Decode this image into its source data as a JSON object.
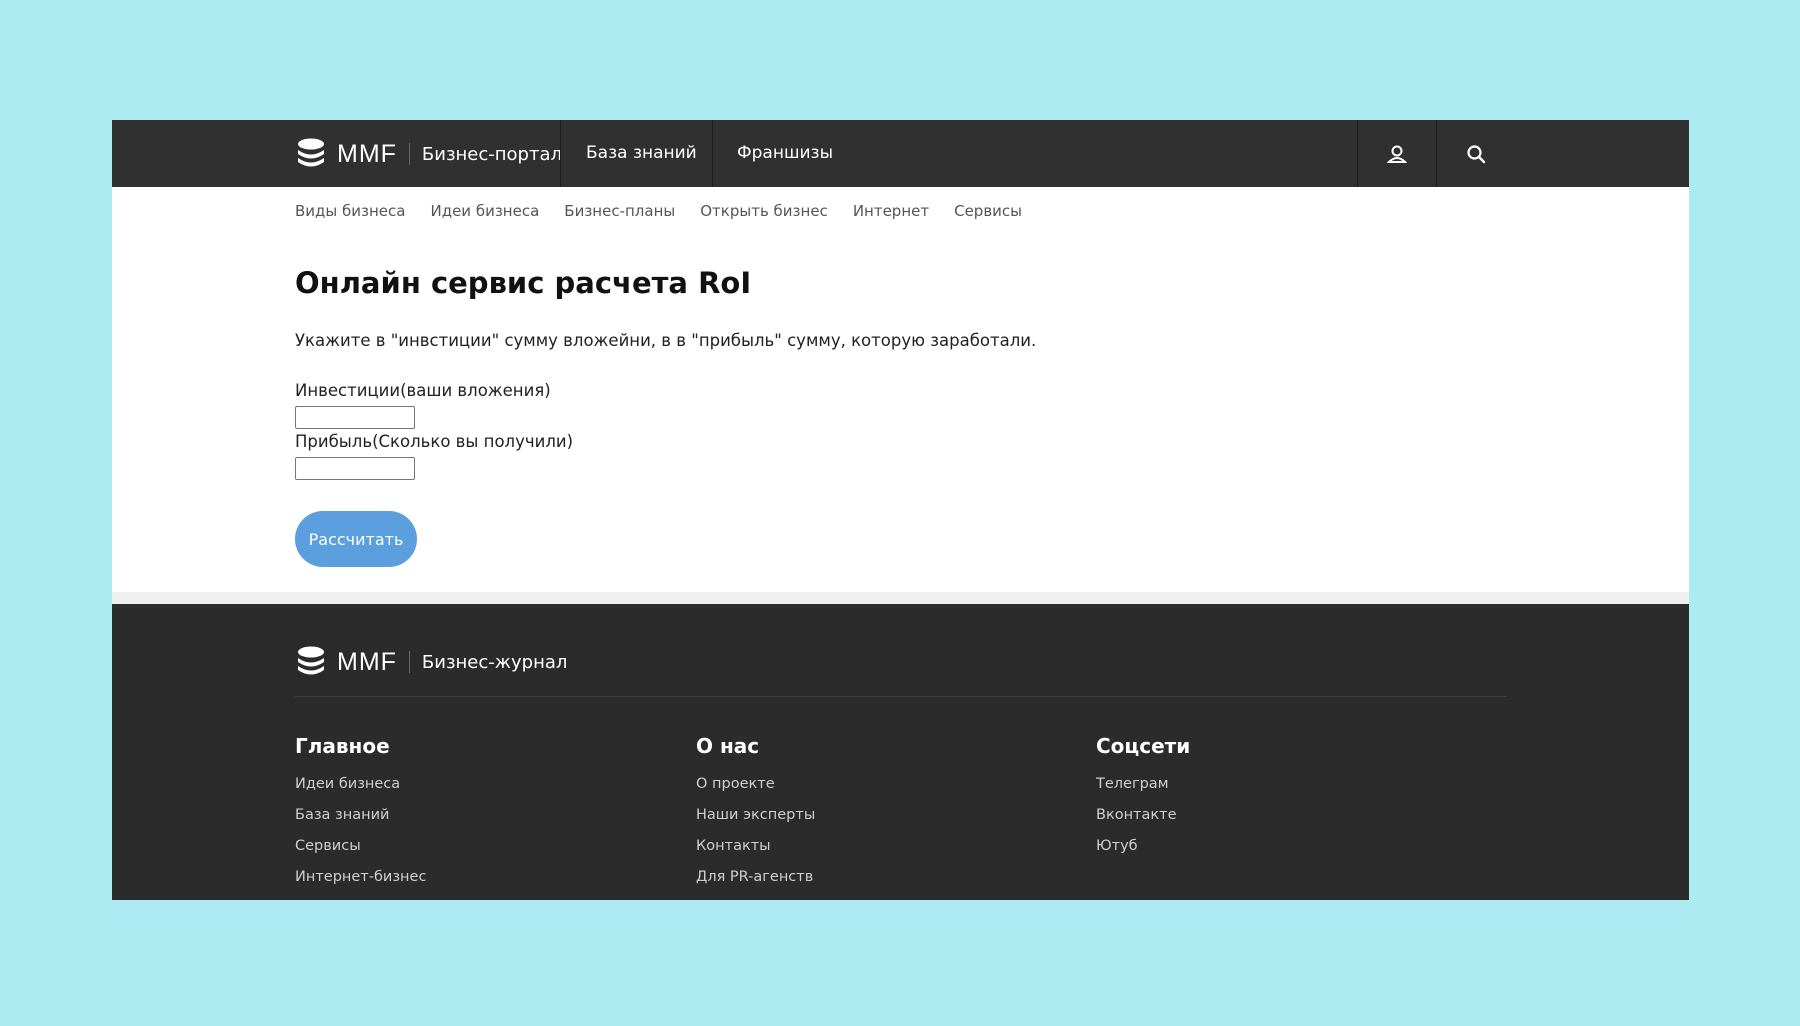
{
  "header": {
    "brand": "MMF",
    "brand_sub": "Бизнес-портал",
    "nav": [
      "База знаний",
      "Франшизы"
    ],
    "icons": [
      "user-icon",
      "search-icon"
    ]
  },
  "subnav": [
    "Виды бизнеса",
    "Идеи бизнеса",
    "Бизнес-планы",
    "Открыть бизнес",
    "Интернет",
    "Сервисы"
  ],
  "main": {
    "title": "Онлайн сервис расчета RoI",
    "lead": "Укажите в \"инвстиции\" сумму вложейни, в в \"прибыль\" сумму, которую заработали.",
    "investments_label": "Инвестиции(ваши вложения)",
    "investments_value": "",
    "profit_label": "Прибыль(Сколько вы получили)",
    "profit_value": "",
    "button": "Рассчитать"
  },
  "footer": {
    "brand": "MMF",
    "brand_sub": "Бизнес-журнал",
    "columns": [
      {
        "title": "Главное",
        "links": [
          "Идеи бизнеса",
          "База знаний",
          "Сервисы",
          "Интернет-бизнес"
        ]
      },
      {
        "title": "О нас",
        "links": [
          "О проекте",
          "Наши эксперты",
          "Контакты",
          "Для PR-агенств"
        ]
      },
      {
        "title": "Соцсети",
        "links": [
          "Телеграм",
          "Вконтакте",
          "Ютуб"
        ]
      }
    ]
  },
  "colors": {
    "page_bg": "#aeeaf1",
    "header_bg": "#303030",
    "footer_bg": "#2b2b2b",
    "accent": "#5b9fdf"
  }
}
